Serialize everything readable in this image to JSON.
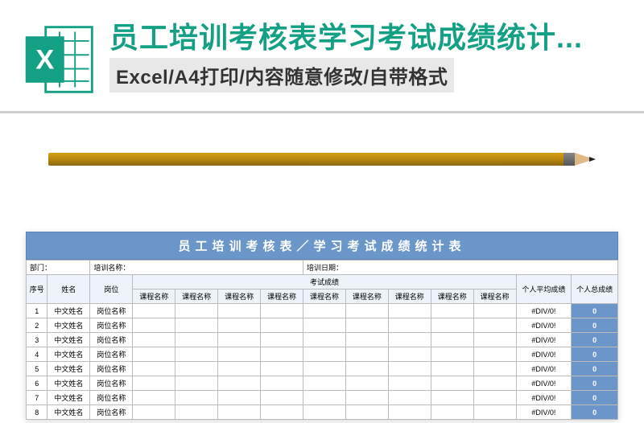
{
  "header": {
    "title": "员工培训考核表学习考试成绩统计...",
    "subtitle": "Excel/A4打印/内容随意修改/自带格式"
  },
  "table": {
    "title": "员工培训考核表／学习考试成绩统计表",
    "meta": {
      "dept_label": "部门：",
      "training_name_label": "培训名称：",
      "training_date_label": "培训日期："
    },
    "headers": {
      "seq": "序号",
      "name": "姓名",
      "position": "岗位",
      "exam_group": "考试成绩",
      "course": "课程名称",
      "avg": "个人平均成绩",
      "total": "个人总成绩"
    },
    "rows": [
      {
        "seq": "1",
        "name": "中文姓名",
        "position": "岗位名称",
        "avg": "#DIV/0!",
        "total": "0"
      },
      {
        "seq": "2",
        "name": "中文姓名",
        "position": "岗位名称",
        "avg": "#DIV/0!",
        "total": "0"
      },
      {
        "seq": "3",
        "name": "中文姓名",
        "position": "岗位名称",
        "avg": "#DIV/0!",
        "total": "0"
      },
      {
        "seq": "4",
        "name": "中文姓名",
        "position": "岗位名称",
        "avg": "#DIV/0!",
        "total": "0"
      },
      {
        "seq": "5",
        "name": "中文姓名",
        "position": "岗位名称",
        "avg": "#DIV/0!",
        "total": "0"
      },
      {
        "seq": "6",
        "name": "中文姓名",
        "position": "岗位名称",
        "avg": "#DIV/0!",
        "total": "0"
      },
      {
        "seq": "7",
        "name": "中文姓名",
        "position": "岗位名称",
        "avg": "#DIV/0!",
        "total": "0"
      },
      {
        "seq": "8",
        "name": "中文姓名",
        "position": "岗位名称",
        "avg": "#DIV/0!",
        "total": "0"
      }
    ],
    "course_count": 9
  }
}
